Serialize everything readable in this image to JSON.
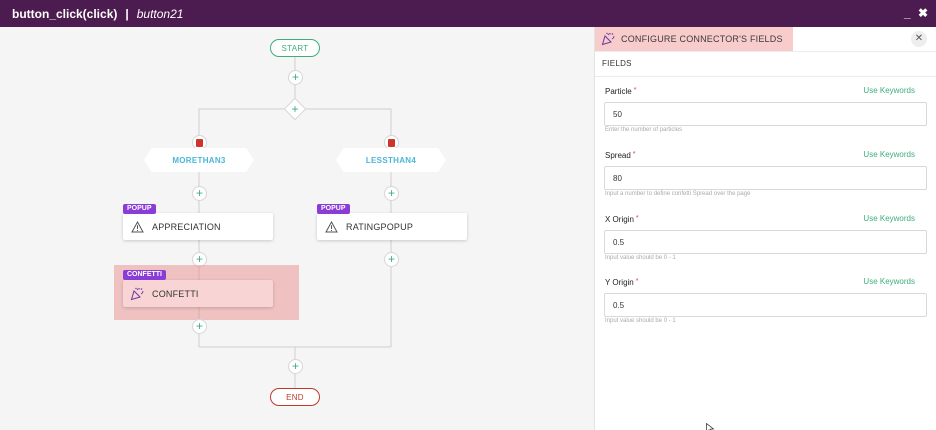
{
  "titlebar": {
    "title": "button_click(click)",
    "separator": "|",
    "subtitle": "button21",
    "minimize": "_",
    "close": "✖"
  },
  "flow": {
    "start": "START",
    "end": "END",
    "plus": "+",
    "branches": [
      {
        "condition": "MORETHAN3",
        "node_type": "POPUP",
        "node_label": "APPRECIATION"
      },
      {
        "condition": "LESSTHAN4",
        "node_type": "POPUP",
        "node_label": "RATINGPOPUP"
      }
    ],
    "confetti": {
      "node_type": "CONFETTI",
      "node_label": "CONFETTI"
    }
  },
  "panel": {
    "title": "CONFIGURE CONNECTOR'S FIELDS",
    "close": "✕",
    "tab": "FIELDS",
    "required_mark": "*",
    "keywords_label": "Use Keywords",
    "fields": [
      {
        "label": "Particle",
        "value": "50",
        "hint": "Enter the number of particles"
      },
      {
        "label": "Spread",
        "value": "80",
        "hint": "Input a number to define confetti Spread over the page"
      },
      {
        "label": "X Origin",
        "value": "0.5",
        "hint": "Input value should be 0 - 1"
      },
      {
        "label": "Y Origin",
        "value": "0.5",
        "hint": "Input value should be 0 - 1"
      }
    ]
  },
  "colors": {
    "titlebar": "#4c1b4f",
    "accent_green": "#3cae7c",
    "condition_blue": "#4ab7d8",
    "badge_purple": "#8a3dd6",
    "highlight_red": "#f9cccc",
    "end_red": "#c0392b"
  }
}
